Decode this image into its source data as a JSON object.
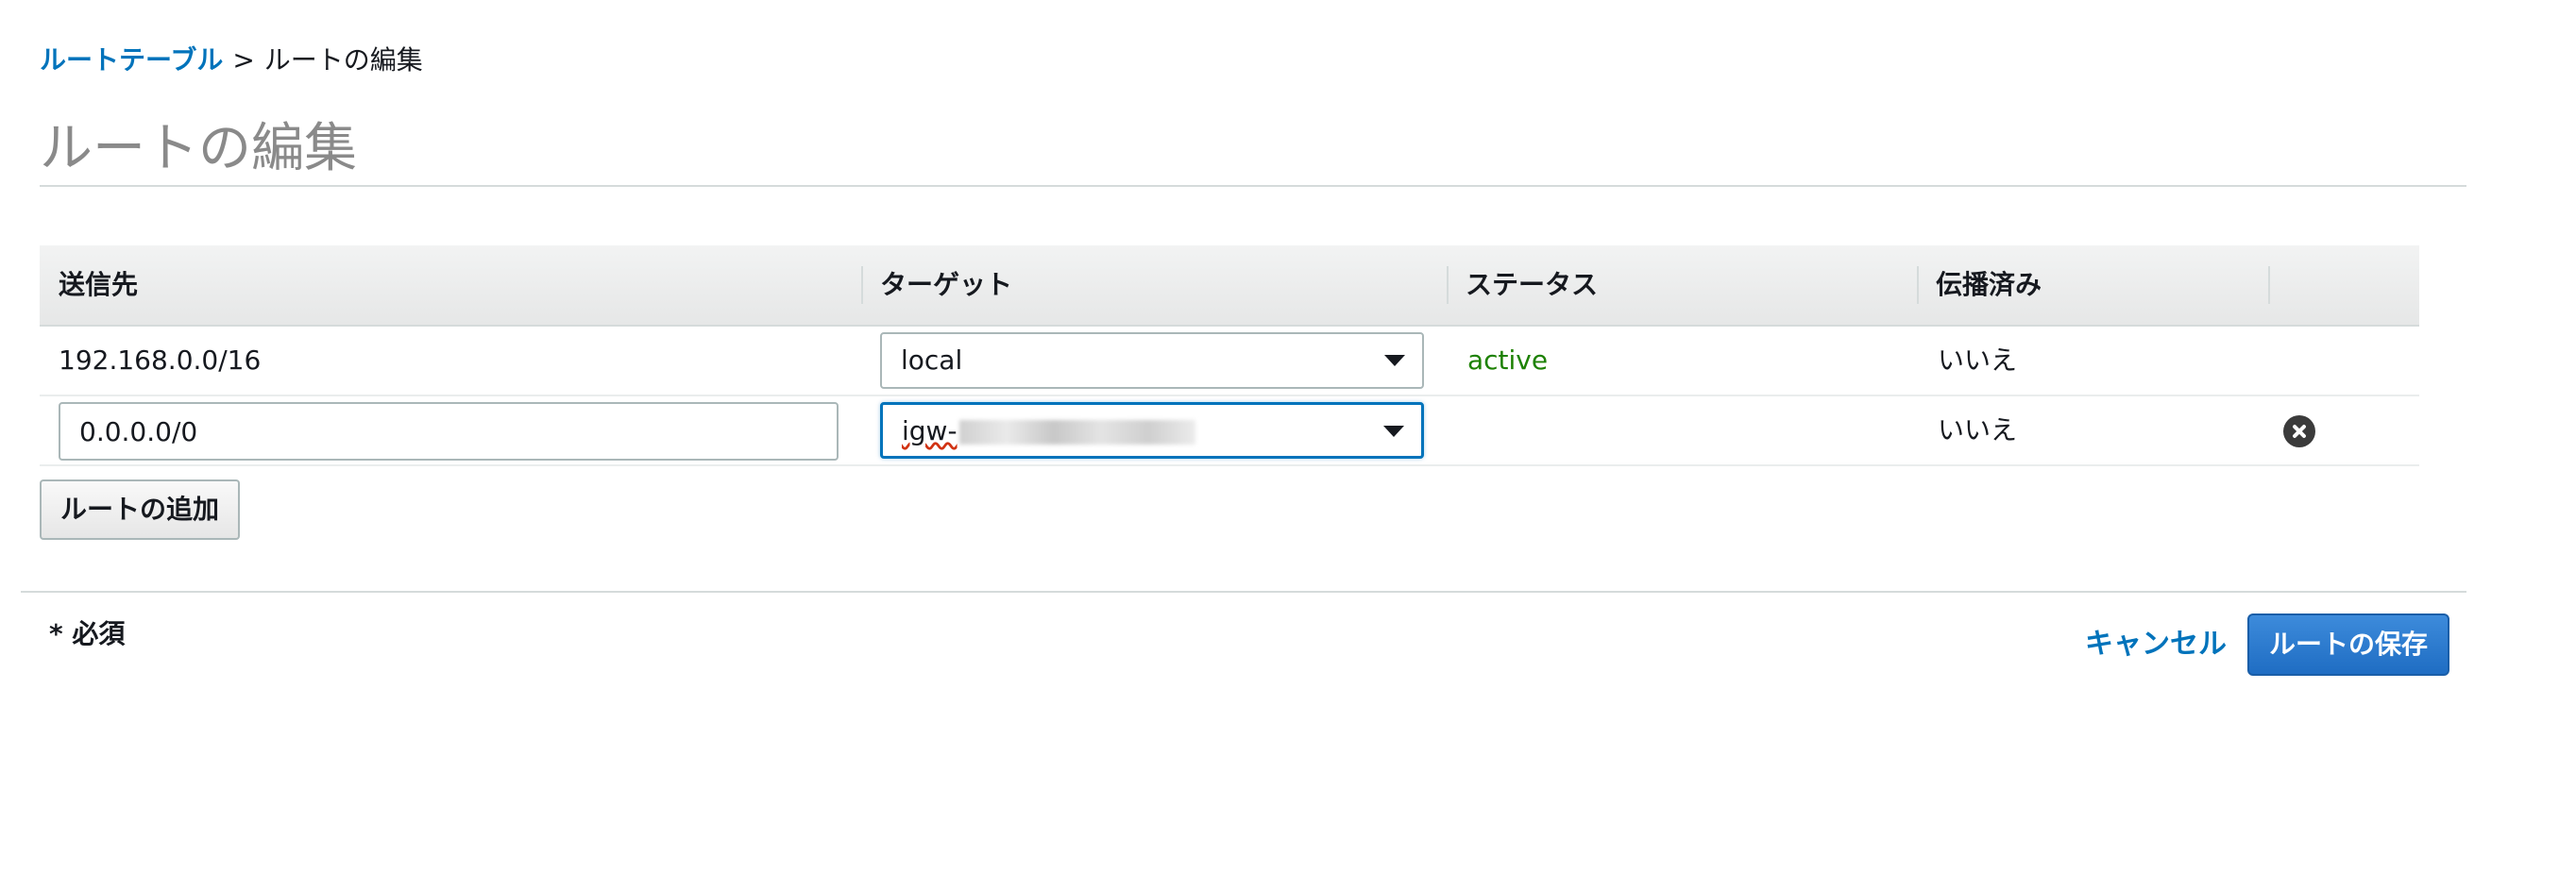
{
  "breadcrumb": {
    "parent": "ルートテーブル",
    "separator": ">",
    "current": "ルートの編集"
  },
  "page": {
    "title": "ルートの編集"
  },
  "table": {
    "headers": [
      "送信先",
      "ターゲット",
      "ステータス",
      "伝播済み"
    ],
    "rows": [
      {
        "destination": "192.168.0.0/16",
        "target": "local",
        "status": "active",
        "propagated": "いいえ"
      },
      {
        "destination": "0.0.0.0/0",
        "target": "igw-",
        "status": "",
        "propagated": "いいえ"
      }
    ]
  },
  "actions": {
    "add_route": "ルートの追加",
    "required_note": "* 必須",
    "cancel": "キャンセル",
    "save": "ルートの保存"
  },
  "icons": {
    "remove": "close-circle-icon",
    "dropdown": "chevron-down-icon"
  },
  "colors": {
    "link": "#0073bb",
    "status_active": "#1d8102",
    "primary_button": "#1f6dc3",
    "focus_border": "#0073bb"
  }
}
